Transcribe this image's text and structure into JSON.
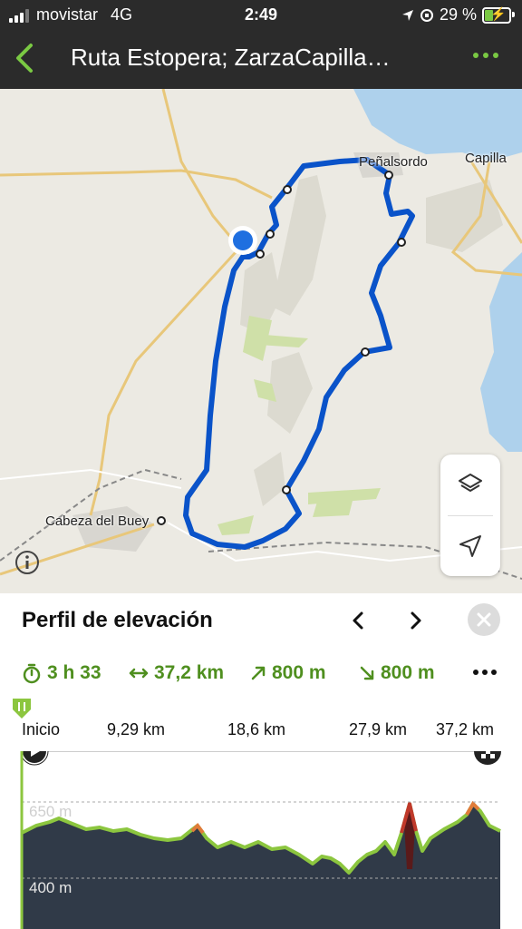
{
  "status": {
    "carrier": "movistar",
    "network": "4G",
    "time": "2:49",
    "battery": "29 %"
  },
  "nav": {
    "title": "Ruta Estopera; ZarzaCapilla…",
    "back_icon": "chevron-left-icon",
    "more_icon": "more-dots-icon",
    "accent": "#7ac943"
  },
  "map": {
    "labels": {
      "penalsordo": "Peñalsordo",
      "capilla": "Capilla",
      "cabeza": "Cabeza del Buey"
    },
    "route_color": "#0a53c9",
    "layers_icon": "layers-icon",
    "locate_icon": "navigation-arrow-icon",
    "info_icon": "info-icon"
  },
  "profile": {
    "title": "Perfil de elevación",
    "prev_icon": "chevron-left-icon",
    "next_icon": "chevron-right-icon",
    "close_icon": "close-icon",
    "stats": {
      "duration": "3 h 33",
      "distance": "37,2 km",
      "ascent": "800 m",
      "descent": "800 m"
    },
    "axis": [
      "Inicio",
      "9,29 km",
      "18,6 km",
      "27,9 km",
      "37,2 km"
    ],
    "elevation_labels": {
      "high": "650 m",
      "low": "400 m"
    }
  }
}
